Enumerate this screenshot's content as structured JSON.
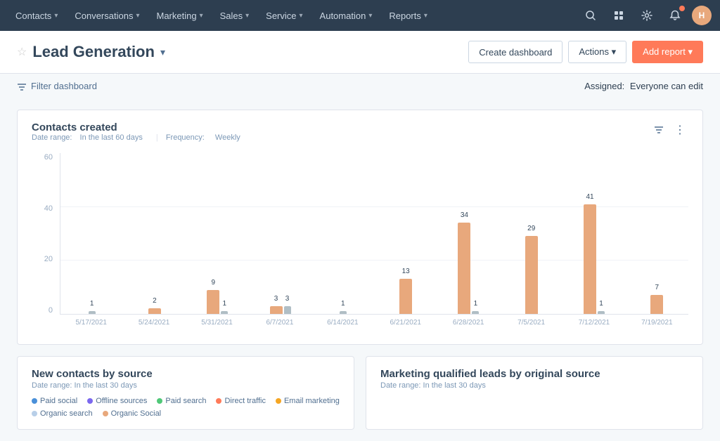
{
  "nav": {
    "items": [
      {
        "label": "Contacts",
        "id": "contacts"
      },
      {
        "label": "Conversations",
        "id": "conversations"
      },
      {
        "label": "Marketing",
        "id": "marketing"
      },
      {
        "label": "Sales",
        "id": "sales"
      },
      {
        "label": "Service",
        "id": "service"
      },
      {
        "label": "Automation",
        "id": "automation"
      },
      {
        "label": "Reports",
        "id": "reports"
      }
    ]
  },
  "header": {
    "star_label": "☆",
    "title": "Lead Generation",
    "create_dashboard_label": "Create dashboard",
    "actions_label": "Actions ▾",
    "add_report_label": "Add report ▾"
  },
  "filter": {
    "filter_label": "Filter dashboard",
    "assigned_label": "Assigned:",
    "assigned_value": "Everyone can edit"
  },
  "chart": {
    "title": "Contacts created",
    "date_range_label": "Date range:",
    "date_range_value": "In the last 60 days",
    "frequency_label": "Frequency:",
    "frequency_value": "Weekly",
    "y_labels": [
      "60",
      "40",
      "20",
      "0"
    ],
    "x_labels": [
      "5/17/2021",
      "5/24/2021",
      "5/31/2021",
      "6/7/2021",
      "6/14/2021",
      "6/21/2021",
      "6/28/2021",
      "7/5/2021",
      "7/12/2021",
      "7/19/2021"
    ],
    "bars": [
      {
        "orange": 1,
        "gray": 0
      },
      {
        "orange": 0,
        "gray": 2
      },
      {
        "orange": 1,
        "gray": 9
      },
      {
        "orange": 3,
        "gray": 3
      },
      {
        "orange": 1,
        "gray": 0
      },
      {
        "orange": 0,
        "gray": 13
      },
      {
        "orange": 1,
        "gray": 34
      },
      {
        "orange": 0,
        "gray": 29
      },
      {
        "orange": 1,
        "gray": 41
      },
      {
        "orange": 0,
        "gray": 7
      }
    ]
  },
  "bottom_left": {
    "title": "New contacts by source",
    "date_range": "Date range: In the last 30 days",
    "legend": [
      {
        "label": "Paid social",
        "color": "#4a90d9"
      },
      {
        "label": "Offline sources",
        "color": "#7b68ee"
      },
      {
        "label": "Paid search",
        "color": "#50c878"
      },
      {
        "label": "Direct traffic",
        "color": "#ff7a59"
      },
      {
        "label": "Email marketing",
        "color": "#f5a623"
      },
      {
        "label": "Organic search",
        "color": "#b8cfe8"
      },
      {
        "label": "Organic Social",
        "color": "#e8a87c"
      }
    ]
  },
  "bottom_right": {
    "title": "Marketing qualified leads by original source",
    "date_range": "Date range: In the last 30 days"
  }
}
